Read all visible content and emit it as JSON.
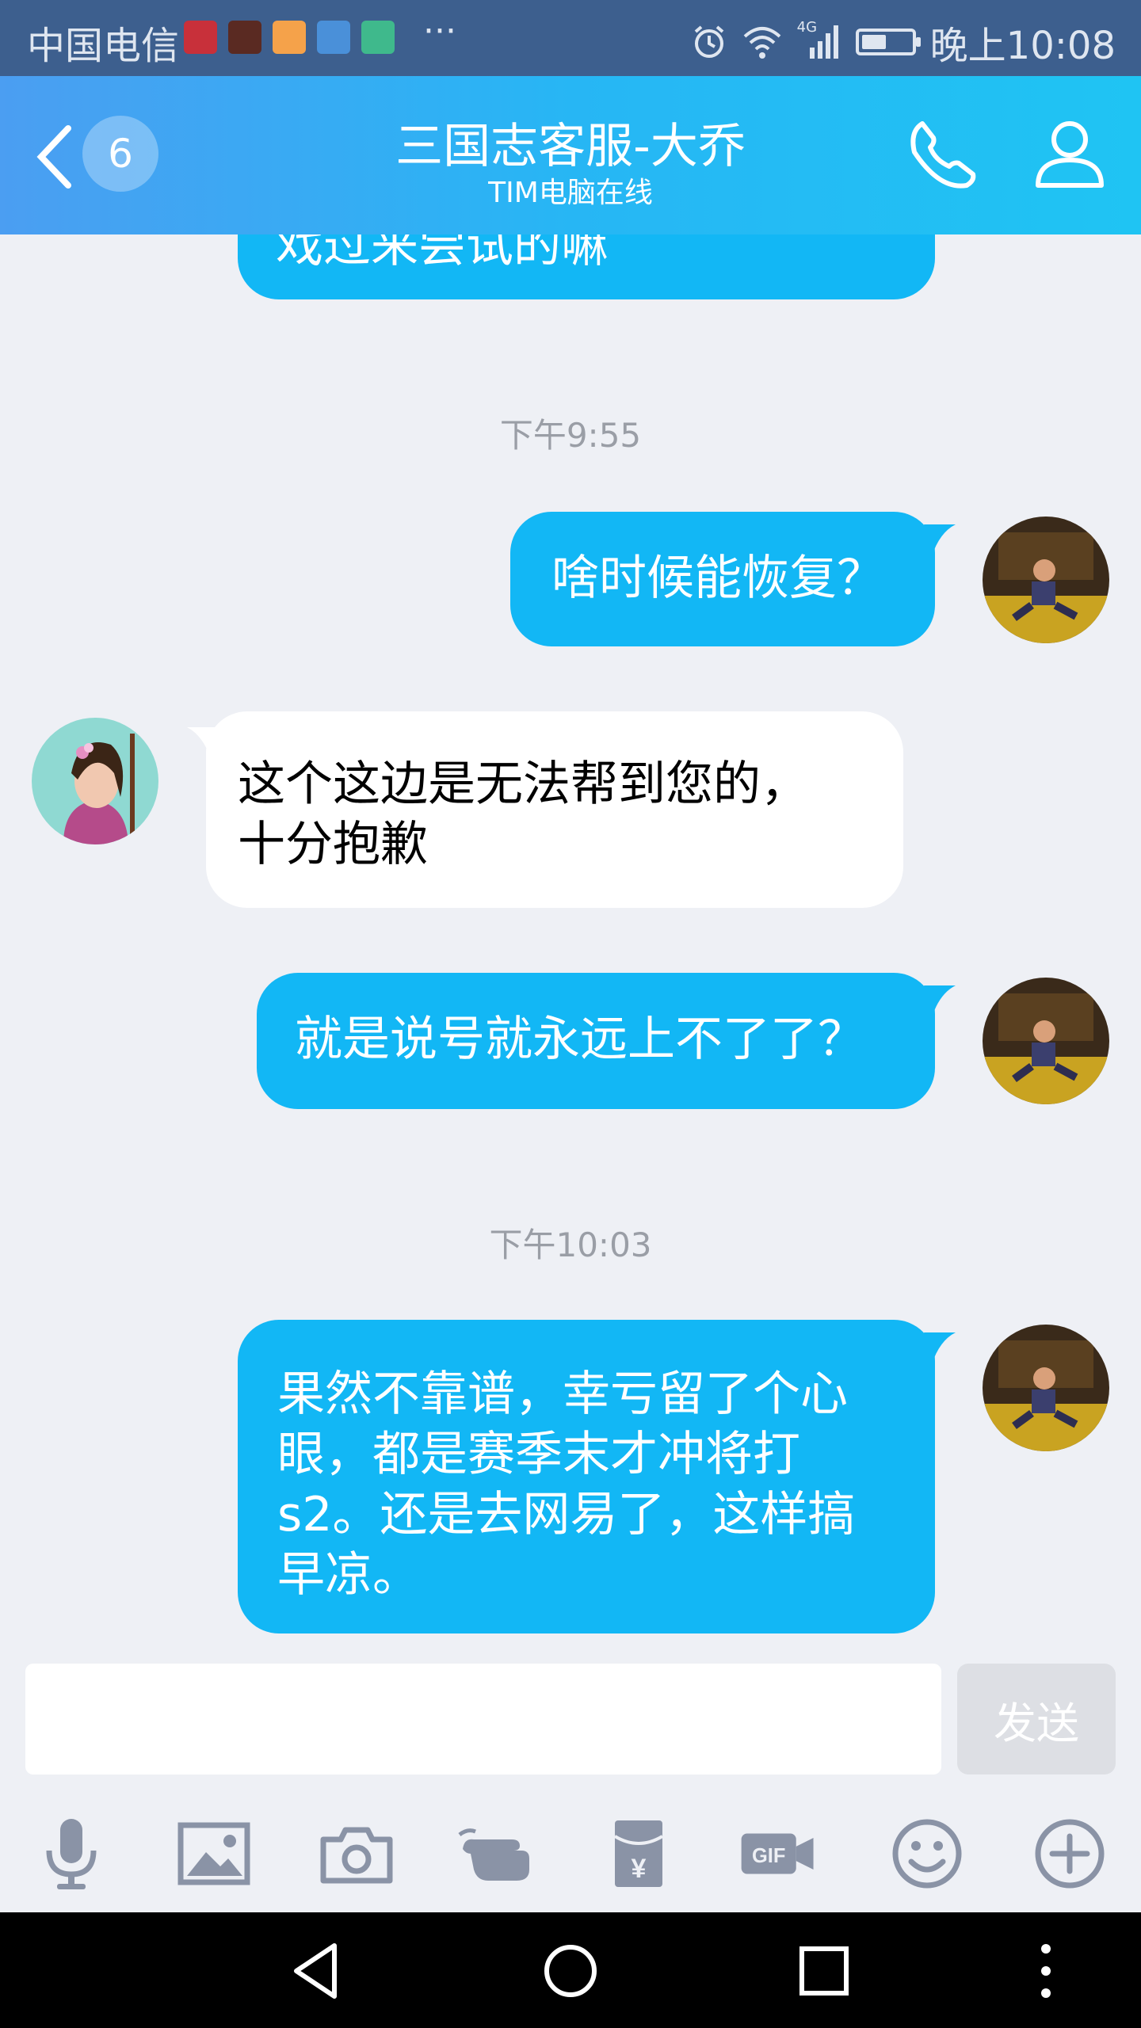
{
  "status_bar": {
    "carrier": "中国电信",
    "more": "···",
    "time": "晚上10:08",
    "network": "4G"
  },
  "header": {
    "unread_count": "6",
    "title": "三国志客服-大乔",
    "subtitle": "TIM电脑在线"
  },
  "messages": {
    "m0": {
      "text": "戏过来尝试的嘛"
    },
    "t1": "下午9:55",
    "m1": {
      "text": "啥时候能恢复？"
    },
    "m2": {
      "line1": "这个这边是无法帮到您的，",
      "line2": "十分抱歉"
    },
    "m3": {
      "text": "就是说号就永远上不了了？"
    },
    "t2": "下午10:03",
    "m4": {
      "line1": "果然不靠谱，幸亏留了个心",
      "line2": "眼，都是赛季末才冲将打",
      "line3": "s2。还是去网易了，这样搞",
      "line4": "早凉。"
    }
  },
  "input": {
    "value": "",
    "send_label": "发送"
  },
  "colors": {
    "status_bar": "#3d5f8e",
    "header_start": "#4b9ef2",
    "header_end": "#1fc4f3",
    "outgoing_bubble": "#12b7f5",
    "incoming_bubble": "#ffffff",
    "background": "#eef0f5",
    "toolbar_icon": "#8a93a6"
  }
}
